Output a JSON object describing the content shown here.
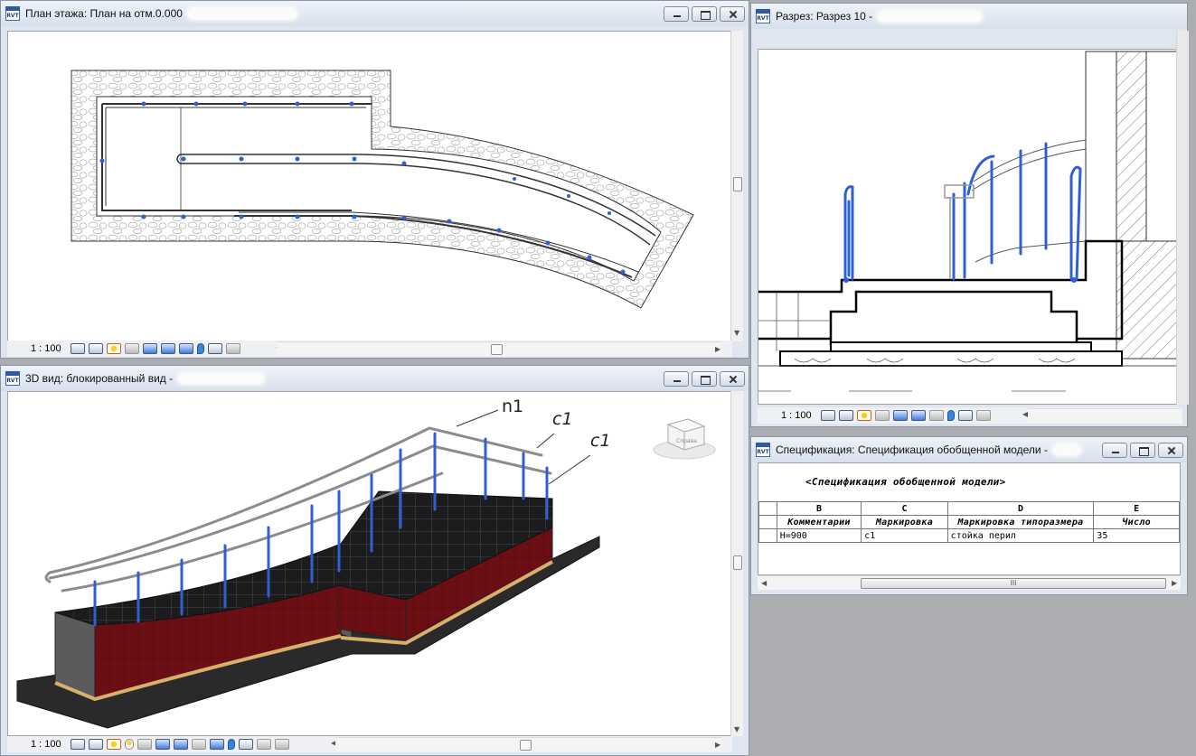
{
  "windows": {
    "plan": {
      "title": "План этажа: План на отм.0.000",
      "scale": "1 : 100",
      "icon_label": "RVT"
    },
    "section": {
      "title": "Разрез: Разрез 10 - ",
      "scale": "1 : 100",
      "icon_label": "RVT"
    },
    "view3d": {
      "title": "3D вид: блокированный вид - ",
      "scale": "1 : 100",
      "icon_label": "RVT",
      "callouts": [
        "n1",
        "c1",
        "c1"
      ],
      "viewcube_label": "Справа"
    },
    "schedule": {
      "title": "Спецификация: Спецификация обобщенной модели - ",
      "icon_label": "RVT",
      "heading": "<Спецификация обобщенной модели>",
      "column_letters": [
        "B",
        "C",
        "D",
        "E"
      ],
      "column_names": [
        "Комментарии",
        "Маркировка",
        "Маркировка типоразмера",
        "Число"
      ],
      "rows": [
        [
          "H=900",
          "c1",
          "стойка перил",
          "35"
        ]
      ],
      "hscroll_grip": "III"
    }
  },
  "colors": {
    "rail_blue": "#2f5fd8",
    "tile_red": "#6b0f14",
    "title_bar": "#dde6f1",
    "workspace": "#abadb0"
  },
  "icons": {
    "doc": "revit-document-icon",
    "minimize": "minimize-icon",
    "maximize": "maximize-icon",
    "close": "close-icon"
  }
}
